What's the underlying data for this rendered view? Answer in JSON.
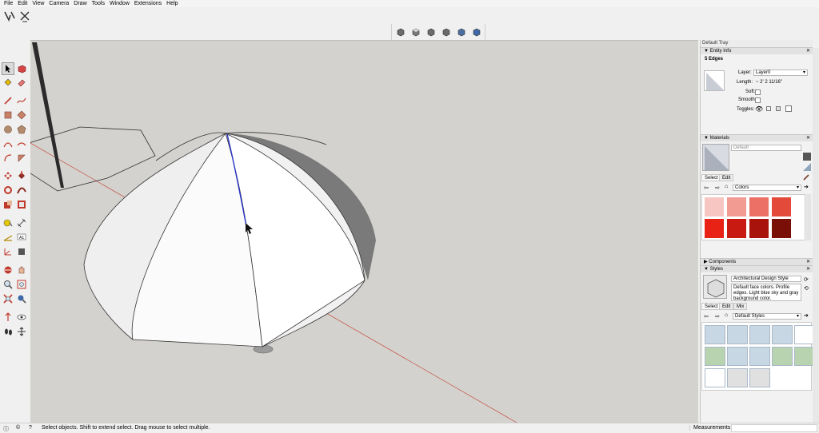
{
  "menu": [
    "File",
    "Edit",
    "View",
    "Camera",
    "Draw",
    "Tools",
    "Window",
    "Extensions",
    "Help"
  ],
  "status": {
    "message": "Select objects. Shift to extend select. Drag mouse to select multiple.",
    "measurements_label": "Measurements",
    "measurements_value": ""
  },
  "tray": {
    "title": "Default Tray",
    "entity_info": {
      "header": "Entity Info",
      "selection": "5 Edges",
      "layer_label": "Layer:",
      "layer_value": "Layer0",
      "length_label": "Length:",
      "length_value": "~ 2' 2 11/16\"",
      "soft_label": "Soft:",
      "smooth_label": "Smooth:",
      "toggles_label": "Toggles:"
    },
    "materials": {
      "header": "Materials",
      "current": "Default",
      "tab_select": "Select",
      "tab_edit": "Edit",
      "library": "Colors",
      "swatches": [
        "#f8c6c2",
        "#f19b93",
        "#ec7065",
        "#e44a3a",
        "#e82214",
        "#c81a10",
        "#a8140c",
        "#7a0f08"
      ]
    },
    "components": {
      "header": "Components"
    },
    "styles": {
      "header": "Styles",
      "name": "Architectural Design Style",
      "description": "Default face colors. Profile edges. Light blue sky and gray background color.",
      "tab_select": "Select",
      "tab_edit": "Edit",
      "tab_mix": "Mix",
      "library": "Default Styles"
    }
  },
  "colors": {
    "viewport_bg": "#d4d2ce",
    "selected_edge": "#2a35c8",
    "red_axis": "#c0392b"
  }
}
